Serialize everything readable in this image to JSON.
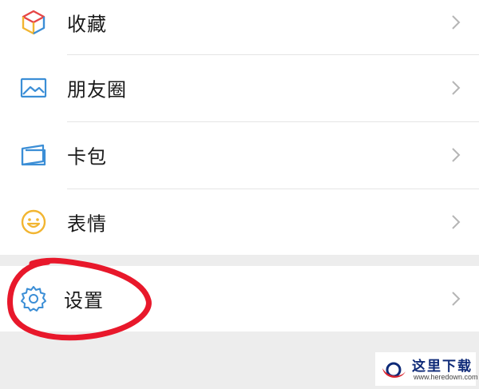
{
  "menu": {
    "items": [
      {
        "label": "收藏",
        "icon": "favorites-cube-icon"
      },
      {
        "label": "朋友圈",
        "icon": "moments-picture-icon"
      },
      {
        "label": "卡包",
        "icon": "card-wallet-icon"
      },
      {
        "label": "表情",
        "icon": "sticker-smiley-icon"
      }
    ],
    "settings": {
      "label": "设置",
      "icon": "gear-icon"
    }
  },
  "annotation": {
    "color": "#e8182b"
  },
  "watermark": {
    "title": "这里下载",
    "url": "www.heredown.com"
  },
  "colors": {
    "icon_blue": "#3b8ed6",
    "icon_yellow": "#f2b531",
    "icon_red": "#e64545",
    "chevron": "#b5b5b5"
  }
}
